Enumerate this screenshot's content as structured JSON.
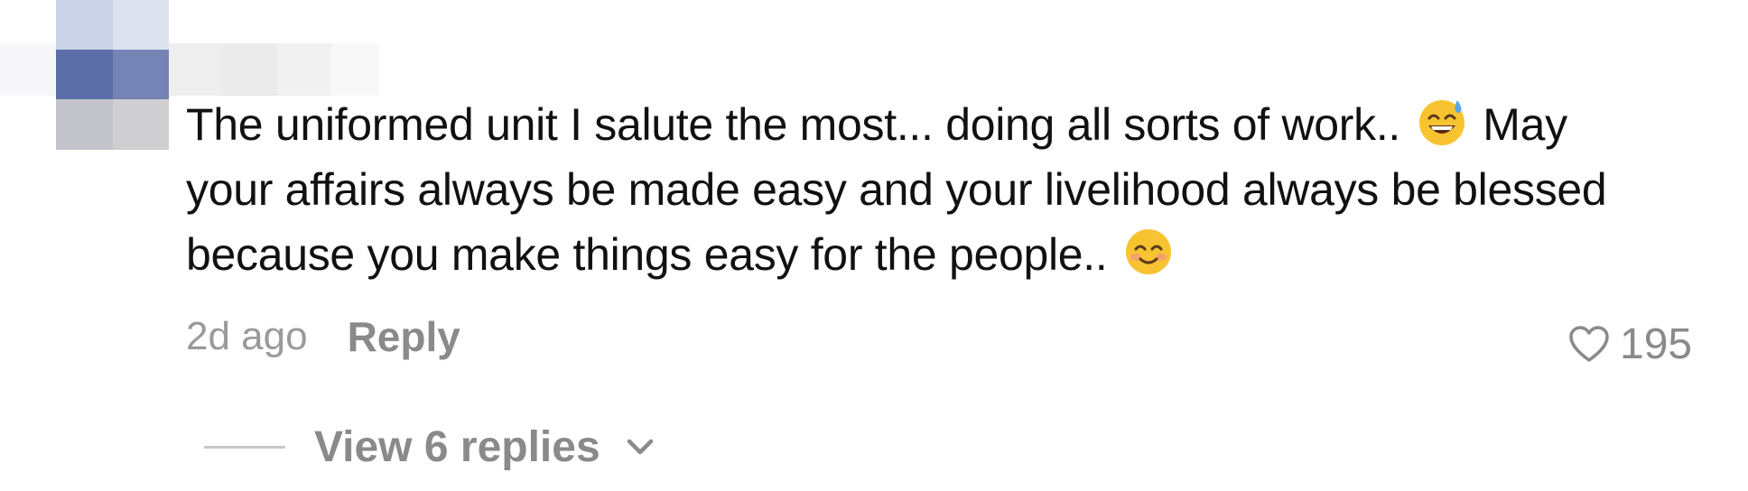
{
  "comment": {
    "text_line1": "The uniformed unit I salute the most... doing all sorts of work.. ",
    "text_line1_after_emoji": " May",
    "text_line2": "your affairs always be made easy and your livelihood always be blessed",
    "text_line3": "because you make things easy for the people.. ",
    "emoji1": "grinning-face-with-sweat-icon",
    "emoji2": "smiling-face-with-smiling-eyes-icon",
    "timestamp": "2d ago",
    "reply_label": "Reply",
    "like_count": "195",
    "view_replies_label": "View 6 replies"
  },
  "colors": {
    "text": "#111111",
    "meta": "#8a8a8a",
    "emoji_yellow": "#f7c331"
  }
}
